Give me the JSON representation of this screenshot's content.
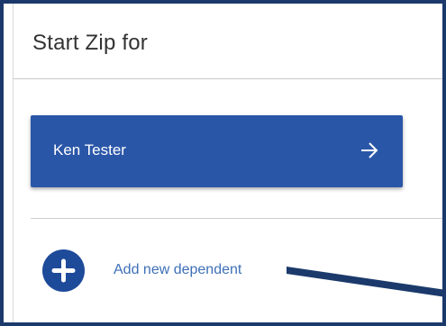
{
  "header": {
    "title": "Start Zip for"
  },
  "dependents": {
    "items": [
      {
        "name": "Ken Tester",
        "icon": "arrow-right-icon"
      }
    ]
  },
  "add_dependent": {
    "label": "Add new dependent",
    "icon": "plus-icon"
  },
  "colors": {
    "primary": "#2a56a8",
    "add_button": "#1e4a9a",
    "link_text": "#3e6fb6",
    "frame_border": "#1b3a6b",
    "annotation_line": "#1b3a6b"
  }
}
